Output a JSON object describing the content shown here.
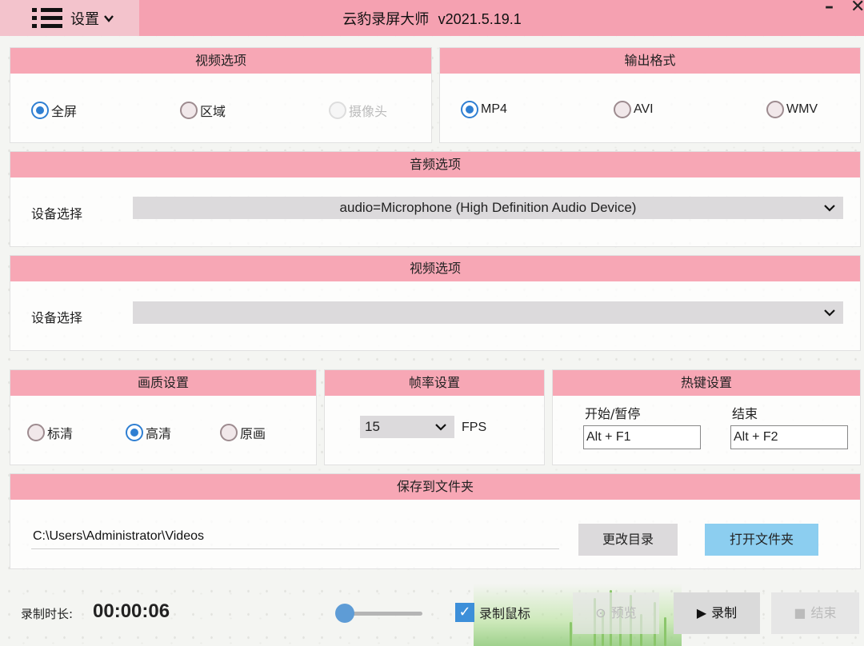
{
  "titlebar": {
    "menu_label": "设置",
    "app_title": "云豹录屏大师",
    "version": "v2021.5.19.1",
    "minimize_symbol": "–",
    "close_symbol": "✕"
  },
  "video_options": {
    "title": "视频选项",
    "options": [
      "全屏",
      "区域",
      "摄像头"
    ],
    "selected": "全屏",
    "disabled": [
      "摄像头"
    ]
  },
  "output_format": {
    "title": "输出格式",
    "options": [
      "MP4",
      "AVI",
      "WMV"
    ],
    "selected": "MP4"
  },
  "audio_options": {
    "title": "音频选项",
    "device_label": "设备选择",
    "device_value": "audio=Microphone (High Definition Audio Device)"
  },
  "video_device": {
    "title": "视频选项",
    "device_label": "设备选择",
    "device_value": ""
  },
  "quality": {
    "title": "画质设置",
    "options": [
      "标清",
      "高清",
      "原画"
    ],
    "selected": "高清"
  },
  "framerate": {
    "title": "帧率设置",
    "value": "15",
    "unit": "FPS"
  },
  "hotkeys": {
    "title": "热键设置",
    "start_pause_label": "开始/暂停",
    "start_pause_value": "Alt + F1",
    "stop_label": "结束",
    "stop_value": "Alt + F2"
  },
  "save_folder": {
    "title": "保存到文件夹",
    "path": "C:\\Users\\Administrator\\Videos",
    "change_dir_label": "更改目录",
    "open_folder_label": "打开文件夹"
  },
  "bottom": {
    "duration_label": "录制时长:",
    "duration_value": "00:00:06",
    "volume_level": 0.02,
    "record_mouse_label": "录制鼠标",
    "record_mouse_checked": true,
    "preview_label": "预览",
    "record_label": "录制",
    "stop_label": "结束"
  },
  "colors": {
    "titlebar": "#f5a1b1",
    "panel_header": "#f7a7b5",
    "radio_selected": "#2f7fd2",
    "open_folder_button": "#8ccef0"
  },
  "icons": [
    "menu-icon",
    "chevron-down-icon",
    "minimize-icon",
    "close-icon",
    "play-icon",
    "stop-icon",
    "checkbox-check-icon"
  ]
}
